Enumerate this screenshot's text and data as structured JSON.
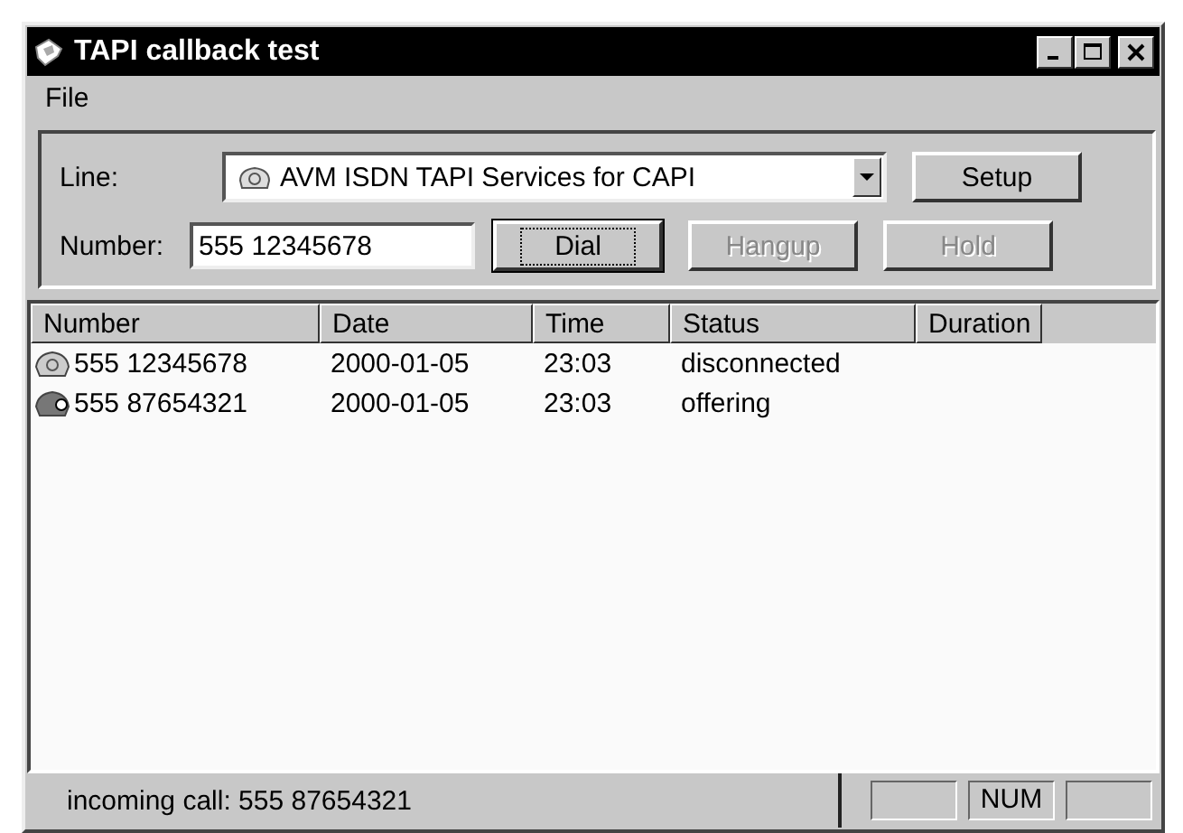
{
  "window": {
    "title": "TAPI callback test"
  },
  "menu": [
    {
      "label": "File"
    }
  ],
  "line": {
    "label": "Line:",
    "value": "AVM ISDN TAPI Services for CAPI"
  },
  "number": {
    "label": "Number:",
    "value": "555 12345678"
  },
  "buttons": [
    {
      "label": "Setup",
      "disabled": false,
      "focused": false
    },
    {
      "label": "Dial",
      "disabled": false,
      "focused": true
    },
    {
      "label": "Hangup",
      "disabled": true,
      "focused": false
    },
    {
      "label": "Hold",
      "disabled": true,
      "focused": false
    }
  ],
  "table": {
    "columns": [
      "Number",
      "Date",
      "Time",
      "Status",
      "Duration"
    ],
    "rows": [
      {
        "kind": "idle",
        "cells": [
          "555 12345678",
          "2000-01-05",
          "23:03",
          "disconnected"
        ]
      },
      {
        "kind": "ringing",
        "cells": [
          "555 87654321",
          "2000-01-05",
          "23:03",
          "offering"
        ]
      }
    ]
  },
  "status_bar": {
    "message": "incoming call: 555 87654321",
    "indicator": "NUM"
  }
}
